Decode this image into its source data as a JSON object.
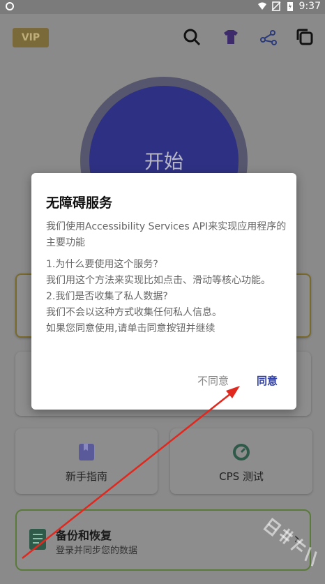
{
  "status_bar": {
    "time": "9:37"
  },
  "app": {
    "vip_label": "VIP",
    "start_label": "开始",
    "cards": [
      {
        "label": "新手指南"
      },
      {
        "label": "CPS 测试"
      }
    ],
    "backup": {
      "title": "备份和恢复",
      "subtitle": "登录并同步您的数据"
    }
  },
  "dialog": {
    "title": "无障碍服务",
    "paragraphs": [
      "我们使用Accessibility Services API来实现应用程序的主要功能",
      "1.为什么要使用这个服务?",
      "我们用这个方法来实现比如点击、滑动等核心功能。",
      "2.我们是否收集了私人数据?",
      "我们不会以这种方式收集任何私人信息。",
      "如果您同意使用,请单击同意按钮并继续"
    ],
    "disagree_label": "不同意",
    "agree_label": "同意"
  },
  "colors": {
    "accent": "#3242a8",
    "start_circle": "#2e3183",
    "annotation_arrow": "#e0281e"
  },
  "watermark": "日升在线"
}
